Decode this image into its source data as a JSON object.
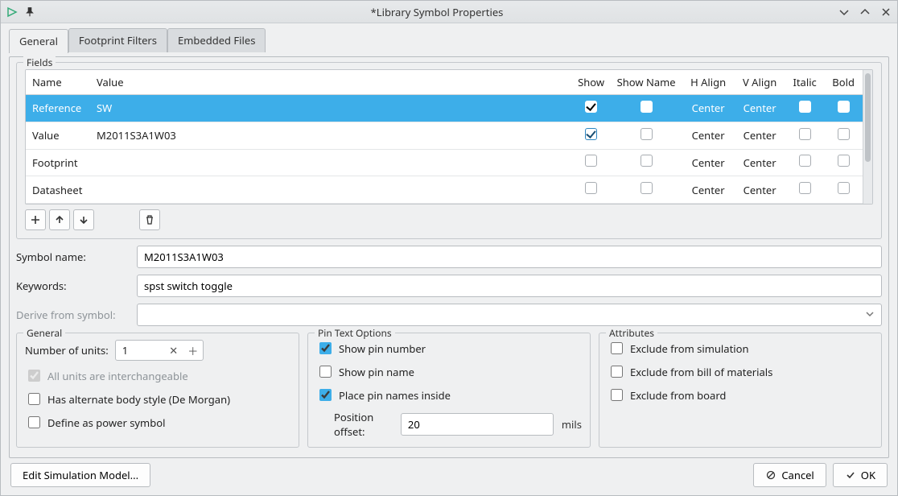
{
  "window": {
    "title": "*Library Symbol Properties"
  },
  "tabs": [
    {
      "label": "General",
      "active": true
    },
    {
      "label": "Footprint Filters",
      "active": false
    },
    {
      "label": "Embedded Files",
      "active": false
    }
  ],
  "fields_group_label": "Fields",
  "fields_table": {
    "headers": {
      "name": "Name",
      "value": "Value",
      "show": "Show",
      "show_name": "Show Name",
      "h_align": "H Align",
      "v_align": "V Align",
      "italic": "Italic",
      "bold": "Bold"
    },
    "rows": [
      {
        "name": "Reference",
        "value": "SW",
        "show": true,
        "show_name": false,
        "h_align": "Center",
        "v_align": "Center",
        "italic": false,
        "bold": false,
        "selected": true
      },
      {
        "name": "Value",
        "value": "M2011S3A1W03",
        "show": true,
        "show_name": false,
        "h_align": "Center",
        "v_align": "Center",
        "italic": false,
        "bold": false,
        "selected": false
      },
      {
        "name": "Footprint",
        "value": "",
        "show": false,
        "show_name": false,
        "h_align": "Center",
        "v_align": "Center",
        "italic": false,
        "bold": false,
        "selected": false
      },
      {
        "name": "Datasheet",
        "value": "",
        "show": false,
        "show_name": false,
        "h_align": "Center",
        "v_align": "Center",
        "italic": false,
        "bold": false,
        "selected": false
      }
    ]
  },
  "form": {
    "symbol_name_label": "Symbol name:",
    "symbol_name_value": "M2011S3A1W03",
    "keywords_label": "Keywords:",
    "keywords_value": "spst switch toggle",
    "derive_label": "Derive from symbol:",
    "derive_value": ""
  },
  "general_group": {
    "legend": "General",
    "units_label": "Number of units:",
    "units_value": "1",
    "interchangeable_label": "All units are interchangeable",
    "interchangeable_checked": true,
    "alt_body_label": "Has alternate body style (De Morgan)",
    "alt_body_checked": false,
    "power_label": "Define as power symbol",
    "power_checked": false
  },
  "pin_group": {
    "legend": "Pin Text Options",
    "show_pin_number_label": "Show pin number",
    "show_pin_number_checked": true,
    "show_pin_name_label": "Show pin name",
    "show_pin_name_checked": false,
    "place_inside_label": "Place pin names inside",
    "place_inside_checked": true,
    "offset_label": "Position offset:",
    "offset_value": "20",
    "offset_unit": "mils"
  },
  "attr_group": {
    "legend": "Attributes",
    "ex_sim_label": "Exclude from simulation",
    "ex_sim_checked": false,
    "ex_bom_label": "Exclude from bill of materials",
    "ex_bom_checked": false,
    "ex_board_label": "Exclude from board",
    "ex_board_checked": false
  },
  "buttons": {
    "edit_sim": "Edit Simulation Model...",
    "cancel": "Cancel",
    "ok": "OK"
  }
}
